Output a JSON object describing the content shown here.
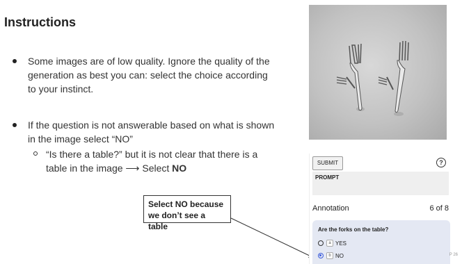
{
  "slide": {
    "title": "Instructions",
    "bullets": [
      "Some images are of low quality. Ignore the quality of the generation as best you can: select the choice according to your instinct.",
      "If the question is not answerable based on what is shown in the image select “NO”"
    ],
    "sub_bullet_text": "“Is there a table?” but it is not clear that there is a table in the image ⟶ Select ",
    "sub_bullet_emphasis": "NO",
    "callout": "Select NO because we don’t see a table",
    "page": "P 26"
  },
  "panel": {
    "submit_label": "SUBMIT",
    "help_icon": "?",
    "prompt_label": "PROMPT",
    "annotation_label": "Annotation",
    "count": "6 of 8",
    "question": "Are the forks on the table?",
    "options": [
      {
        "key": "a",
        "label": "YES",
        "selected": false
      },
      {
        "key": "b",
        "label": "NO",
        "selected": true
      }
    ]
  },
  "colors": {
    "accent": "#3b5bdb",
    "question_bg": "#e4e8f3"
  }
}
